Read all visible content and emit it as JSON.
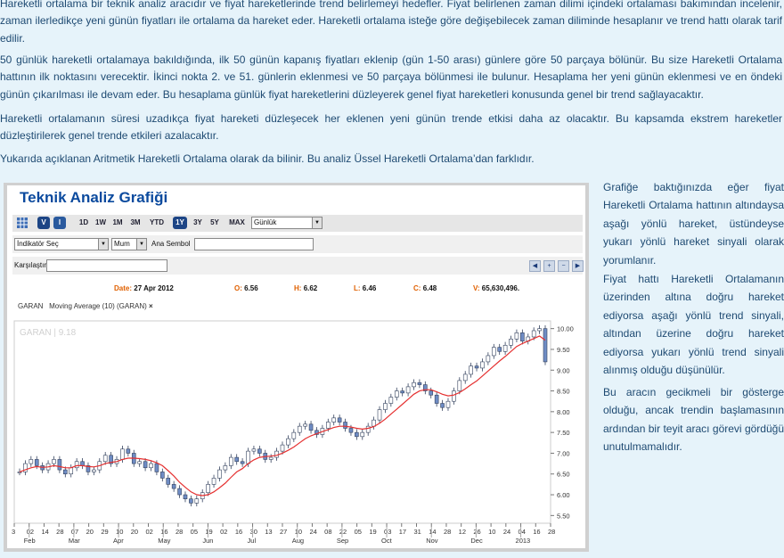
{
  "article": {
    "p1": "Hareketli ortalama bir teknik analiz aracıdır ve fiyat hareketlerinde trend belirlemeyi hedefler. Fiyat belirlenen zaman dilimi içindeki ortalaması bakımından incelenir, zaman ilerledikçe yeni günün fiyatları ile ortalama da hareket eder. Hareketli ortalama isteğe göre değişebilecek zaman diliminde hesaplanır ve trend hattı olarak tarif edilir.",
    "p2": "50 günlük hareketli ortalamaya bakıldığında, ilk 50 günün kapanış fiyatları eklenip (gün 1-50 arası) günlere göre 50 parçaya bölünür. Bu size Hareketli Ortalama hattının ilk noktasını verecektir. İkinci nokta 2. ve 51. günlerin eklenmesi ve 50 parçaya bölünmesi ile bulunur. Hesaplama her yeni günün eklenmesi ve en öndeki günün çıkarılması ile devam eder. Bu hesaplama günlük fiyat hareketlerini düzleyerek genel fiyat hareketleri konusunda genel bir trend sağlayacaktır.",
    "p3": "Hareketli ortalamanın süresi uzadıkça fiyat hareketi düzleşecek her eklenen yeni günün trende etkisi daha az olacaktır. Bu kapsamda ekstrem hareketler düzleştirilerek genel trende etkileri azalacaktır.",
    "p4": "Yukarıda açıklanan Aritmetik Hareketli Ortalama olarak da bilinir. Bu analiz Üssel Hareketli Ortalama’dan farklıdır."
  },
  "side": {
    "s1": "Grafiğe baktığınızda eğer fiyat Hareketli Ortalama hattının altındaysa aşağı yönlü hareket, üstündeyse yukarı yönlü hareket sinyali olarak yorumlanır.",
    "s2": "Fiyat hattı Hareketli Ortalamanın üzerinden altına doğru hareket ediyorsa aşağı yönlü trend sinyali, altından üzerine doğru hareket ediyorsa yukarı yönlü trend sinyali alınmış olduğu düşünülür.",
    "s3": "Bu aracın gecikmeli bir gösterge olduğu, ancak trendin başlamasının ardından bir teyit aracı görevi gördüğü unutulmamalıdır."
  },
  "widget": {
    "title": "Teknik Analiz Grafiği",
    "chart_type_icons": [
      "V",
      "I"
    ],
    "ranges": [
      "1D",
      "1W",
      "1M",
      "3M",
      "YTD",
      "1Y",
      "3Y",
      "5Y",
      "MAX"
    ],
    "active_range": "1Y",
    "period": "Günlük",
    "indicator": "İndikatör Seç",
    "indicator_type": "Mum",
    "symbol_label": "Ana Sembol",
    "compare_label": "Karşılaştır",
    "ohlc": {
      "date_label": "Date:",
      "date": "27 Apr 2012",
      "o_label": "O:",
      "o": "6.56",
      "h_label": "H:",
      "h": "6.62",
      "l_label": "L:",
      "l": "6.46",
      "c_label": "C:",
      "c": "6.48",
      "v_label": "V:",
      "v": "65,630,496."
    },
    "legend_symbol": "GARAN",
    "legend_ma": "Moving Average (10) (GARAN)",
    "legend_close": "×",
    "watermark": "GARAN | 9.18",
    "colors": {
      "up": "#6f8cc4",
      "down": "#6f8cc4",
      "ma": "#e53030",
      "accent": "#0b4a9e"
    }
  },
  "chart_data": {
    "type": "line",
    "x_tick_labels": [
      "3",
      "02",
      "14",
      "28",
      "07",
      "20",
      "29",
      "10",
      "20",
      "02",
      "16",
      "28",
      "05",
      "19",
      "02",
      "16",
      "30",
      "13",
      "27",
      "10",
      "24",
      "08",
      "22",
      "05",
      "19",
      "03",
      "17",
      "31",
      "14",
      "28",
      "12",
      "26",
      "10",
      "24",
      "04",
      "16",
      "28"
    ],
    "month_labels": [
      "Feb",
      "Mar",
      "Apr",
      "May",
      "Jun",
      "Jul",
      "Aug",
      "Sep",
      "Oct",
      "Nov",
      "Dec",
      "2013"
    ],
    "y_ticks": [
      5.5,
      6.0,
      6.5,
      7.0,
      7.5,
      8.0,
      8.5,
      9.0,
      9.5,
      10.0
    ],
    "ylim": [
      5.4,
      10.1
    ],
    "series": [
      {
        "name": "GARAN",
        "values": [
          6.55,
          6.75,
          6.85,
          6.7,
          6.6,
          6.75,
          6.85,
          6.6,
          6.5,
          6.65,
          6.8,
          6.7,
          6.55,
          6.6,
          6.8,
          6.95,
          6.75,
          6.85,
          7.1,
          7.0,
          6.75,
          6.8,
          6.65,
          6.75,
          6.55,
          6.4,
          6.25,
          6.15,
          6.0,
          5.9,
          5.8,
          5.9,
          6.05,
          6.25,
          6.4,
          6.6,
          6.7,
          6.9,
          6.8,
          6.75,
          7.05,
          7.1,
          7.0,
          6.85,
          6.9,
          7.05,
          7.2,
          7.35,
          7.5,
          7.65,
          7.7,
          7.55,
          7.45,
          7.6,
          7.75,
          7.85,
          7.75,
          7.6,
          7.5,
          7.4,
          7.5,
          7.65,
          7.8,
          8.05,
          8.2,
          8.35,
          8.5,
          8.45,
          8.6,
          8.7,
          8.65,
          8.5,
          8.4,
          8.2,
          8.1,
          8.25,
          8.5,
          8.75,
          8.9,
          9.1,
          9.05,
          9.2,
          9.35,
          9.55,
          9.45,
          9.6,
          9.75,
          9.9,
          9.7,
          9.8,
          9.95,
          10.0,
          9.2
        ]
      },
      {
        "name": "Moving Average (10) (GARAN)",
        "values": [
          6.55,
          6.6,
          6.65,
          6.68,
          6.66,
          6.67,
          6.7,
          6.68,
          6.65,
          6.65,
          6.7,
          6.7,
          6.68,
          6.67,
          6.7,
          6.75,
          6.78,
          6.8,
          6.85,
          6.88,
          6.88,
          6.87,
          6.85,
          6.82,
          6.77,
          6.7,
          6.58,
          6.45,
          6.3,
          6.18,
          6.07,
          6.0,
          5.98,
          6.0,
          6.07,
          6.17,
          6.28,
          6.42,
          6.55,
          6.63,
          6.75,
          6.84,
          6.9,
          6.92,
          6.93,
          6.95,
          7.0,
          7.07,
          7.15,
          7.25,
          7.35,
          7.42,
          7.47,
          7.52,
          7.57,
          7.62,
          7.65,
          7.65,
          7.63,
          7.6,
          7.58,
          7.6,
          7.64,
          7.72,
          7.82,
          7.94,
          8.06,
          8.18,
          8.3,
          8.42,
          8.5,
          8.53,
          8.53,
          8.48,
          8.42,
          8.38,
          8.4,
          8.46,
          8.55,
          8.65,
          8.74,
          8.86,
          8.98,
          9.1,
          9.22,
          9.33,
          9.45,
          9.57,
          9.64,
          9.7,
          9.76,
          9.82,
          9.72
        ]
      }
    ]
  }
}
